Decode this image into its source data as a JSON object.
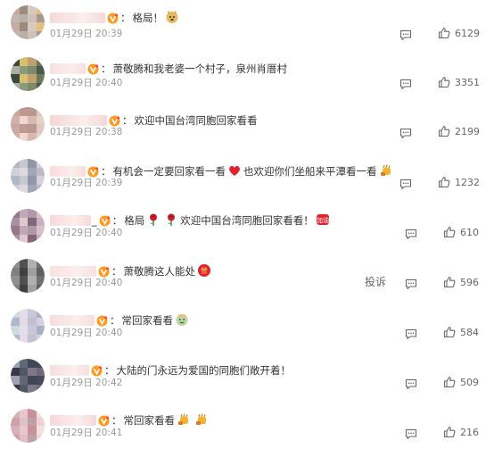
{
  "colors": {
    "text": "#333333",
    "meta": "#999999",
    "accent_red": "#e0242e"
  },
  "icons": {
    "reply": "reply-comment-icon",
    "like": "thumbs-up-icon",
    "badge": "vip-badge-icon"
  },
  "comments": [
    {
      "name_suffix": "",
      "text": "格局！",
      "emojis_after": [
        "doge-emoji"
      ],
      "emojis_mid": [],
      "text2": "",
      "time": "01月29日 20:39",
      "likes": "6129",
      "report": ""
    },
    {
      "name_suffix": "",
      "text": "萧敬腾和我老婆一个村子，泉州肖厝村",
      "emojis_after": [],
      "emojis_mid": [],
      "text2": "",
      "time": "01月29日 20:40",
      "likes": "3351",
      "report": ""
    },
    {
      "name_suffix": "",
      "text": "欢迎中国台湾同胞回家看看",
      "emojis_after": [],
      "emojis_mid": [],
      "text2": "",
      "time": "01月29日 20:38",
      "likes": "2199",
      "report": ""
    },
    {
      "name_suffix": "",
      "text": "有机会一定要回家看一看",
      "emojis_after": [
        "fist-bump-emoji"
      ],
      "emojis_mid": [
        "red-heart-emoji"
      ],
      "text2": "也欢迎你们坐船来平潭看一看",
      "time": "01月29日 20:39",
      "likes": "1232",
      "report": ""
    },
    {
      "name_suffix": "_",
      "text": "格局",
      "emojis_after": [
        "jiayou-emoji"
      ],
      "emojis_mid": [
        "rose-emoji",
        "rose-emoji"
      ],
      "text2": "欢迎中国台湾同胞回家看看！",
      "time": "01月29日 20:40",
      "likes": "610",
      "report": ""
    },
    {
      "name_suffix": "",
      "text": "萧敬腾这人能处",
      "emojis_after": [
        "zan-emoji"
      ],
      "emojis_mid": [],
      "text2": "",
      "time": "01月29日 20:40",
      "likes": "596",
      "report": "投诉"
    },
    {
      "name_suffix": "",
      "text": "常回家看看",
      "emojis_after": [
        "cute-face-emoji"
      ],
      "emojis_mid": [],
      "text2": "",
      "time": "01月29日 20:40",
      "likes": "584",
      "report": ""
    },
    {
      "name_suffix": "",
      "text": "大陆的门永远为爱国的同胞们敞开着！",
      "emojis_after": [],
      "emojis_mid": [],
      "text2": "",
      "time": "01月29日 20:42",
      "likes": "509",
      "report": ""
    },
    {
      "name_suffix": "",
      "text": "常回家看看",
      "emojis_after": [
        "fist-bump-emoji",
        "fist-bump-emoji"
      ],
      "emojis_mid": [],
      "text2": "",
      "time": "01月29日 20:41",
      "likes": "216",
      "report": ""
    }
  ]
}
